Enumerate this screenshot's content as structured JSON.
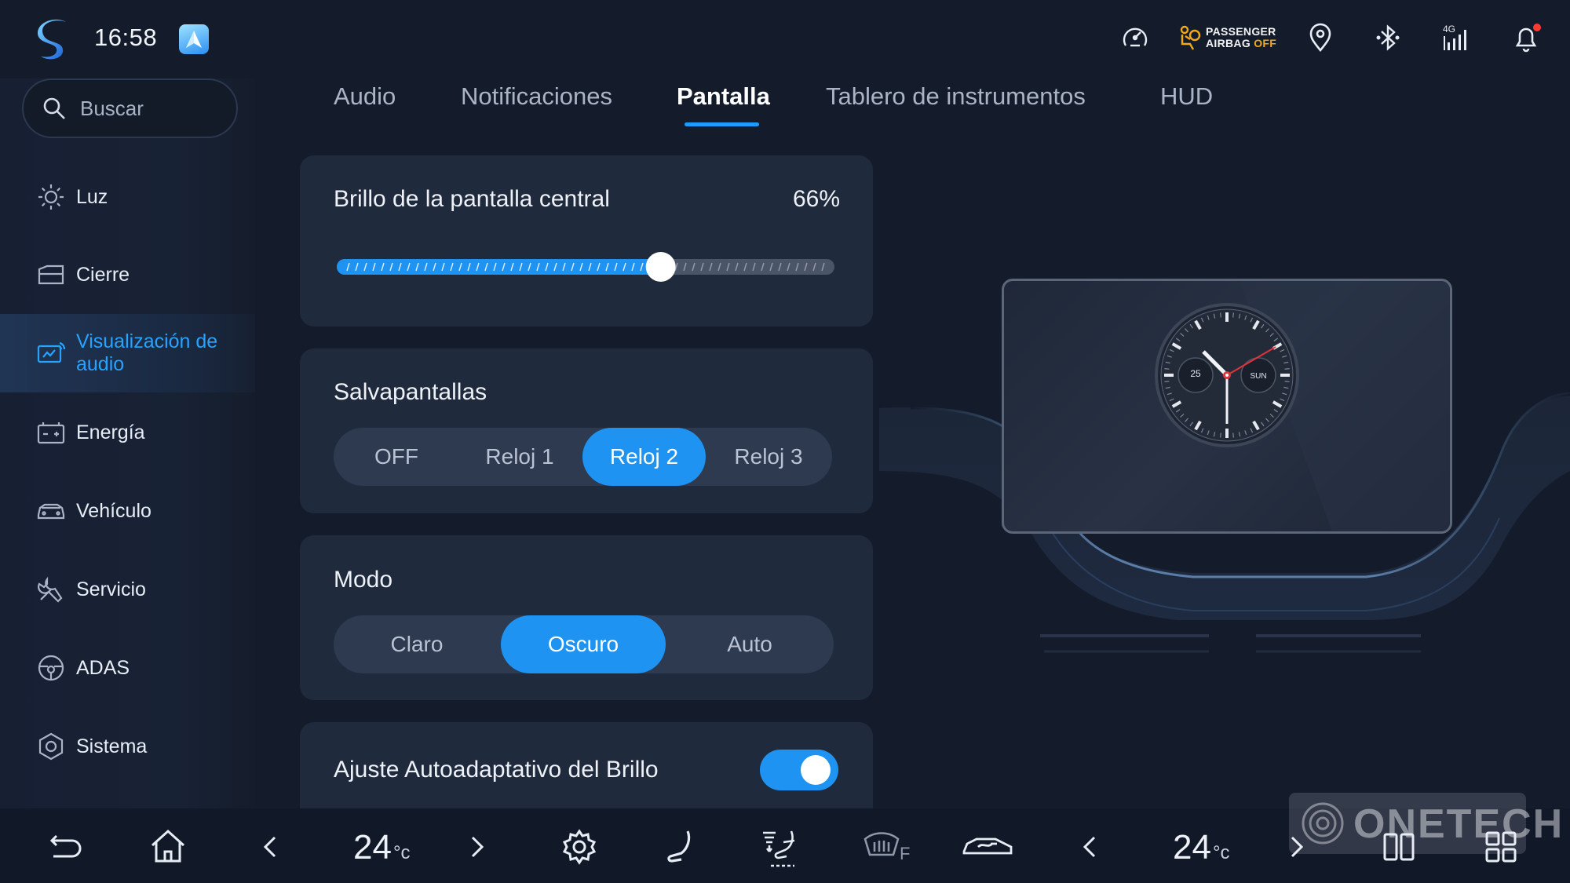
{
  "status_bar": {
    "time": "16:58",
    "airbag_line1": "PASSENGER",
    "airbag_line2": "AIRBAG",
    "airbag_line3": "OFF",
    "icons": [
      "app-logo-icon",
      "navigation-app-icon",
      "speed-sound-icon",
      "passenger-airbag-icon",
      "location-pin-icon",
      "bluetooth-icon",
      "signal-4g-icon",
      "notification-bell-icon"
    ],
    "network_label": "4G"
  },
  "sidebar": {
    "search_placeholder": "Buscar",
    "items": [
      {
        "label": "Luz",
        "icon": "sun-icon"
      },
      {
        "label": "Cierre",
        "icon": "lock-door-icon"
      },
      {
        "label": "Visualización de audio",
        "icon": "audio-visual-icon",
        "active": true
      },
      {
        "label": "Energía",
        "icon": "battery-icon"
      },
      {
        "label": "Vehículo",
        "icon": "car-icon"
      },
      {
        "label": "Servicio",
        "icon": "wrench-icon"
      },
      {
        "label": "ADAS",
        "icon": "steering-wheel-icon"
      },
      {
        "label": "Sistema",
        "icon": "system-gear-icon"
      }
    ]
  },
  "tabs": [
    {
      "label": "Audio"
    },
    {
      "label": "Notificaciones"
    },
    {
      "label": "Pantalla",
      "active": true
    },
    {
      "label": "Tablero de instrumentos"
    },
    {
      "label": "HUD"
    }
  ],
  "brightness": {
    "title": "Brillo de la pantalla central",
    "value_label": "66%",
    "value": 0.66
  },
  "screensaver": {
    "title": "Salvapantallas",
    "options": [
      "OFF",
      "Reloj 1",
      "Reloj 2",
      "Reloj 3"
    ],
    "selected": "Reloj 2"
  },
  "mode": {
    "title": "Modo",
    "options": [
      "Claro",
      "Oscuro",
      "Auto"
    ],
    "selected": "Oscuro"
  },
  "auto_brightness": {
    "title": "Ajuste Autoadaptativo del Brillo",
    "enabled": true
  },
  "preview_clock": {
    "day_number": "25",
    "weekday": "SUN"
  },
  "bottom_bar": {
    "temp_left": "24",
    "temp_right": "24",
    "temp_unit": "°c",
    "rear_defrost_label": "F",
    "icons": [
      "back-icon",
      "home-icon",
      "chevron-left-icon",
      "chevron-right-icon",
      "settings-icon",
      "seat-icon",
      "airflow-icon",
      "defrost-icon",
      "car-fan-icon",
      "split-screen-icon",
      "app-grid-icon"
    ]
  },
  "watermark": {
    "text": "ONETECH"
  },
  "colors": {
    "accent": "#1e93f2",
    "background": "#141c2b",
    "card": "#1f2a3c",
    "warning": "#f4a814"
  }
}
